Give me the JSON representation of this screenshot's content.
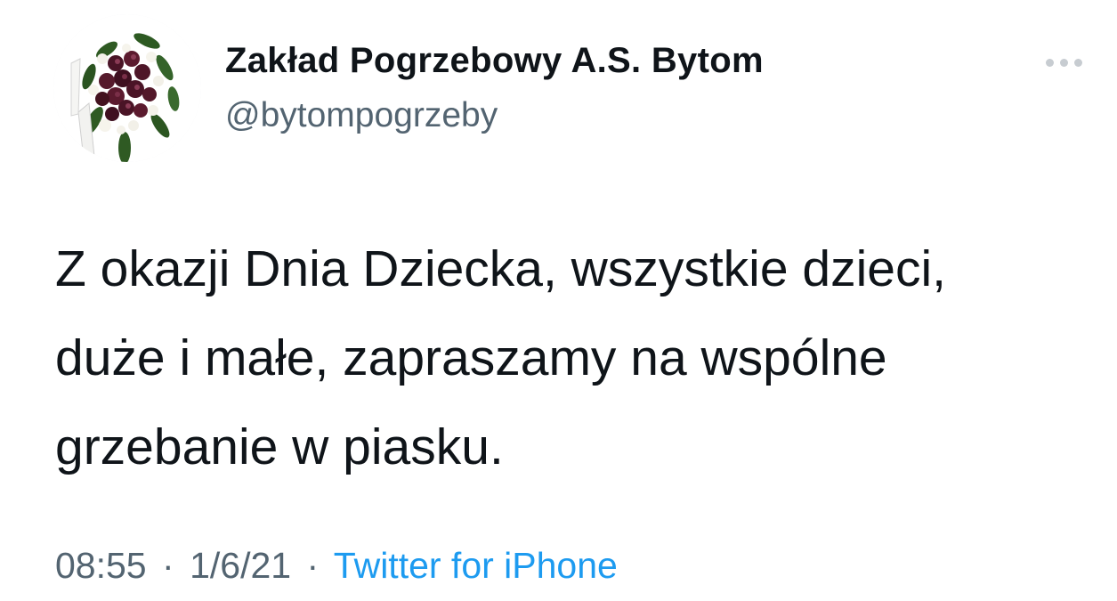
{
  "author": {
    "display_name": "Zakład Pogrzebowy A.S. Bytom",
    "handle": "@bytompogrzeby"
  },
  "tweet": {
    "lines": [
      "Z okazji Dnia Dziecka, wszystkie dzieci,",
      "duże i małe, zapraszamy na wspólne",
      "grzebanie w piasku."
    ]
  },
  "meta": {
    "time": "08:55",
    "separator": "·",
    "date": "1/6/21",
    "source": "Twitter for iPhone"
  },
  "colors": {
    "text": "#0f1419",
    "secondary": "#536471",
    "link": "#1d9bf0"
  },
  "icons": {
    "more": "more-options-icon",
    "avatar": "funeral-wreath-avatar"
  }
}
